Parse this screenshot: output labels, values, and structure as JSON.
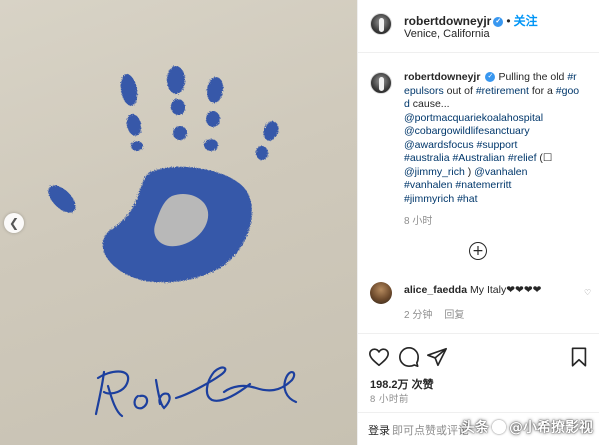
{
  "post": {
    "username": "robertdowneyjr",
    "follow_label": "关注",
    "location": "Venice, California"
  },
  "caption": {
    "username": "robertdowneyjr",
    "segments": [
      {
        "t": "Pulling the old ",
        "tag": false
      },
      {
        "t": "#repulsors",
        "tag": true
      },
      {
        "t": " out of ",
        "tag": false
      },
      {
        "t": "#retirement",
        "tag": true
      },
      {
        "t": " for a ",
        "tag": false
      },
      {
        "t": "#good",
        "tag": true
      },
      {
        "t": " cause...\n",
        "tag": false
      },
      {
        "t": "@portmacquariekoalahospital",
        "tag": true
      },
      {
        "t": "\n",
        "tag": false
      },
      {
        "t": "@cobargowildlifesanctuary",
        "tag": true
      },
      {
        "t": "\n",
        "tag": false
      },
      {
        "t": "@awardsfocus",
        "tag": true
      },
      {
        "t": " ",
        "tag": false
      },
      {
        "t": "#support",
        "tag": true
      },
      {
        "t": "\n",
        "tag": false
      },
      {
        "t": "#australia",
        "tag": true
      },
      {
        "t": " ",
        "tag": false
      },
      {
        "t": "#Australian",
        "tag": true
      },
      {
        "t": " ",
        "tag": false
      },
      {
        "t": "#relief",
        "tag": true
      },
      {
        "t": " (☐\n",
        "tag": false
      },
      {
        "t": "@jimmy_rich",
        "tag": true
      },
      {
        "t": " ) ",
        "tag": false
      },
      {
        "t": "@vanhalen",
        "tag": true
      },
      {
        "t": "\n",
        "tag": false
      },
      {
        "t": "#vanhalen",
        "tag": true
      },
      {
        "t": " ",
        "tag": false
      },
      {
        "t": "#natemerritt",
        "tag": true
      },
      {
        "t": "\n",
        "tag": false
      },
      {
        "t": "#jimmyrich",
        "tag": true
      },
      {
        "t": " ",
        "tag": false
      },
      {
        "t": "#hat",
        "tag": true
      }
    ],
    "time": "8 小时"
  },
  "comment": {
    "username": "alice_faedda",
    "text": "My Italy❤❤❤❤",
    "time": "2 分钟",
    "reply_label": "回复"
  },
  "stats": {
    "likes": "198.2万 次赞",
    "post_time": "8 小时前"
  },
  "login": {
    "link": "登录",
    "rest": "即可点赞或评论"
  },
  "photo": {
    "signature": "Rob"
  },
  "watermark": {
    "prefix": "头条",
    "handle": "@小希撩影视"
  },
  "colors": {
    "ink": "#2a4fa8",
    "link": "#00376b",
    "follow": "#0095f6"
  },
  "icons": [
    "chevron-left-icon",
    "verified-badge-icon",
    "plus-circle-icon",
    "heart-icon",
    "comment-icon",
    "share-icon",
    "bookmark-icon"
  ]
}
